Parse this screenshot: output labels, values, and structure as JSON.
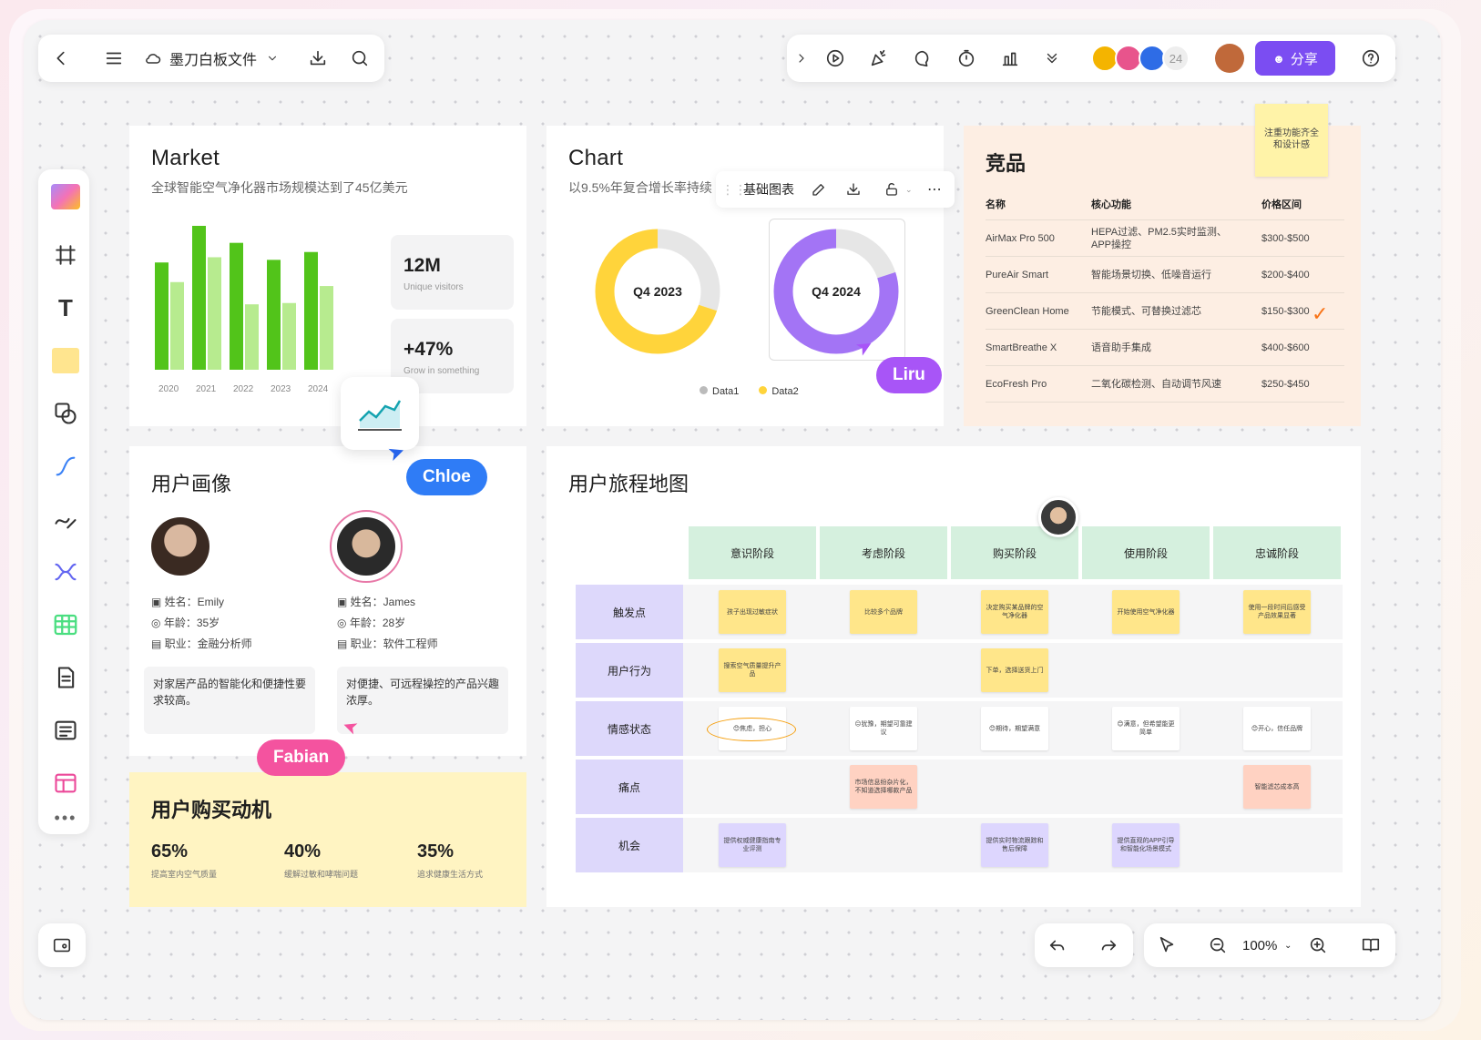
{
  "topbar": {
    "file_name": "墨刀白板文件",
    "collab_count": "24",
    "share_label": "分享"
  },
  "market": {
    "title": "Market",
    "subtitle": "全球智能空气净化器市场规模达到了45亿美元",
    "chart_data": {
      "type": "bar",
      "categories": [
        "2020",
        "2021",
        "2022",
        "2023",
        "2024"
      ],
      "series": [
        {
          "values": [
            82,
            115,
            97,
            84,
            90
          ]
        },
        {
          "values": [
            67,
            86,
            50,
            51,
            64
          ]
        }
      ],
      "ylim": [
        0,
        110
      ],
      "colors": [
        "#52c41a",
        "#b7eb8f"
      ]
    },
    "stat1_value": "12M",
    "stat1_label": "Unique visitors",
    "stat2_value": "+47%",
    "stat2_label": "Grow in something"
  },
  "chart": {
    "title": "Chart",
    "subtitle": "以9.5%年复合增长率持续",
    "toolbar_label": "基础图表",
    "chart_data": [
      {
        "type": "pie",
        "title": "Q4 2023",
        "labels": [
          "Data1",
          "Data2"
        ],
        "values": [
          30,
          70
        ],
        "colors": [
          "#e6e6e6",
          "#ffd43b"
        ]
      },
      {
        "type": "pie",
        "title": "Q4 2024",
        "labels": [
          "Data1",
          "Data2"
        ],
        "values": [
          20,
          80
        ],
        "colors": [
          "#e6e6e6",
          "#a374f5"
        ]
      }
    ],
    "legend": [
      "Data1",
      "Data2"
    ]
  },
  "competitors": {
    "title": "竞品",
    "note": "注重功能齐全和设计感",
    "headers": [
      "名称",
      "核心功能",
      "价格区间"
    ],
    "rows": [
      [
        "AirMax Pro 500",
        "HEPA过滤、PM2.5实时监测、APP操控",
        "$300-$500"
      ],
      [
        "PureAir Smart",
        "智能场景切换、低噪音运行",
        "$200-$400"
      ],
      [
        "GreenClean Home",
        "节能模式、可替换过滤芯",
        "$150-$300"
      ],
      [
        "SmartBreathe X",
        "语音助手集成",
        "$400-$600"
      ],
      [
        "EcoFresh Pro",
        "二氧化碳检测、自动调节风速",
        "$250-$450"
      ]
    ]
  },
  "persona": {
    "title": "用户画像",
    "p1": {
      "name": "姓名：Emily",
      "age": "年龄：35岁",
      "job": "职业：金融分析师",
      "quote": "对家居产品的智能化和便捷性要求较高。"
    },
    "p2": {
      "name": "姓名：James",
      "age": "年龄：28岁",
      "job": "职业：软件工程师",
      "quote": "对便捷、可远程操控的产品兴趣浓厚。"
    }
  },
  "motive": {
    "title": "用户购买动机",
    "items": [
      {
        "v": "65%",
        "l": "提高室内空气质量"
      },
      {
        "v": "40%",
        "l": "缓解过敏和哮喘问题"
      },
      {
        "v": "35%",
        "l": "追求健康生活方式"
      }
    ]
  },
  "journey": {
    "title": "用户旅程地图",
    "stages": [
      "意识阶段",
      "考虑阶段",
      "购买阶段",
      "使用阶段",
      "忠诚阶段"
    ],
    "rows": [
      "触发点",
      "用户行为",
      "情感状态",
      "痛点",
      "机会"
    ],
    "cells": {
      "r0": [
        "孩子出现过敏症状",
        "比较多个品牌",
        "决定购买某品牌的空气净化器",
        "开始使用空气净化器",
        "使用一段时间后感受产品效果显著"
      ],
      "r1": [
        "搜索空气质量提升产品",
        "",
        "下单，选择送货上门",
        "",
        ""
      ],
      "r2": [
        "😊焦虑，担心",
        "😐犹豫，期望可靠建议",
        "😊期待，期望满意",
        "😊满意，但希望能更简单",
        "😊开心，信任品牌"
      ],
      "r3": [
        "",
        "市场信息纷杂片化，不知道选择哪款产品",
        "",
        "",
        "智能滤芯成本高"
      ],
      "r4": [
        "提供权威健康指南专业评测",
        "",
        "提供实时物流跟踪和售后保障",
        "提供直观的APP引导和智能化场景模式",
        ""
      ]
    }
  },
  "cursors": {
    "chloe": "Chloe",
    "fabian": "Fabian",
    "liru": "Liru"
  },
  "zoom": "100%"
}
